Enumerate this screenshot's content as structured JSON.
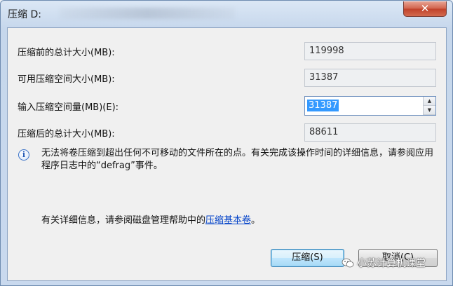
{
  "window": {
    "title": "压缩 D:",
    "close_glyph": "✕"
  },
  "fields": [
    {
      "label": "压缩前的总计大小(MB):",
      "value": "119998"
    },
    {
      "label": "可用压缩空间大小(MB):",
      "value": "31387"
    },
    {
      "label": "输入压缩空间量(MB)(E):",
      "value": "31387"
    },
    {
      "label": "压缩后的总计大小(MB):",
      "value": "88611"
    }
  ],
  "spinner": {
    "up_glyph": "▲",
    "down_glyph": "▼"
  },
  "info": {
    "icon": "info-icon",
    "glyph": "i",
    "text": "无法将卷压缩到超出任何不可移动的文件所在的点。有关完成该操作时间的详细信息，请参阅应用程序日志中的“defrag”事件。"
  },
  "help": {
    "prefix": "有关详细信息，请参阅磁盘管理帮助中的",
    "link": "压缩基本卷",
    "suffix": "。"
  },
  "buttons": {
    "ok": "压缩(S)",
    "cancel": "取消(C)"
  },
  "watermark": "小苏计算机课堂",
  "colors": {
    "link": "#0645c9",
    "selection": "#3399ff",
    "close": "#c0412a"
  }
}
